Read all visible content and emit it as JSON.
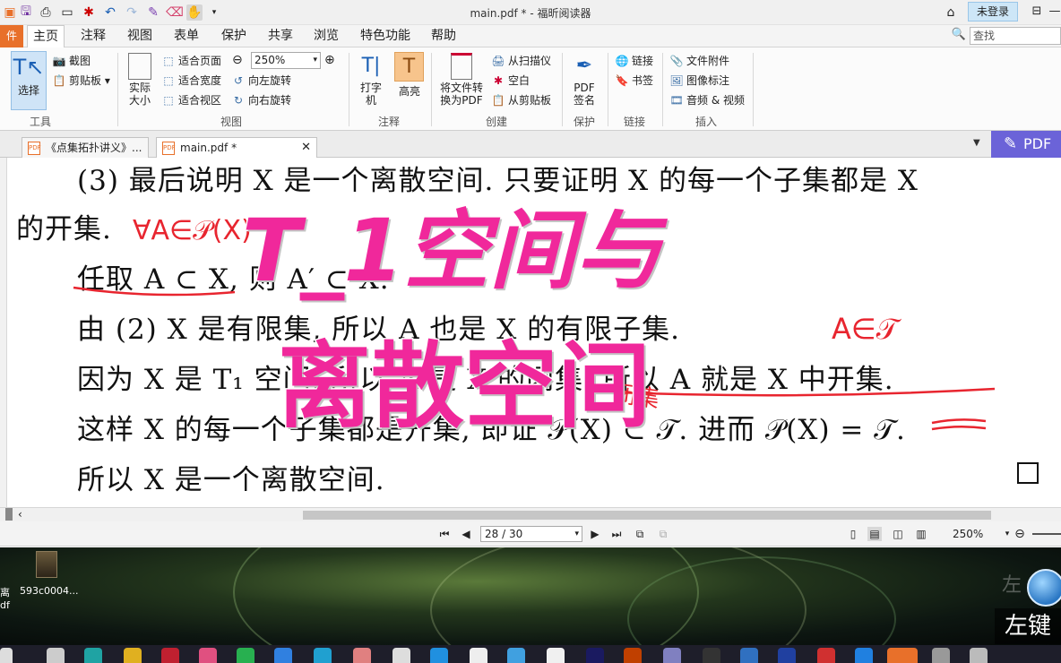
{
  "window": {
    "title": "main.pdf * - 福昕阅读器",
    "login_label": "未登录",
    "controls": [
      "⊟",
      "—"
    ]
  },
  "menu": {
    "file_label": "件",
    "tabs": [
      "主页",
      "注释",
      "视图",
      "表单",
      "保护",
      "共享",
      "浏览",
      "特色功能",
      "帮助"
    ],
    "active_tab": "主页",
    "search_placeholder": "查找"
  },
  "ribbon": {
    "tools": {
      "select_label": "选择",
      "snapshot_label": "截图",
      "clipboard_label": "剪贴板",
      "group_label": "工具"
    },
    "view": {
      "actual_size_label": "实际大小",
      "fit_page_label": "适合页面",
      "fit_width_label": "适合宽度",
      "fit_visible_label": "适合视区",
      "zoom_value": "250%",
      "rotate_left_label": "向左旋转",
      "rotate_right_label": "向右旋转",
      "group_label": "视图"
    },
    "comment": {
      "typewriter_label": "打字机",
      "highlight_label": "高亮",
      "group_label": "注释"
    },
    "create": {
      "convert_label": "将文件转换为PDF",
      "from_scanner_label": "从扫描仪",
      "blank_label": "空白",
      "from_clipboard_label": "从剪贴板",
      "group_label": "创建"
    },
    "protect": {
      "sign_label": "PDF签名",
      "group_label": "保护"
    },
    "links": {
      "link_label": "链接",
      "bookmark_label": "书签",
      "group_label": "链接"
    },
    "insert": {
      "attachment_label": "文件附件",
      "image_annot_label": "图像标注",
      "audio_video_label": "音频 & 视频",
      "group_label": "插入"
    }
  },
  "doc_tabs": [
    {
      "label": "《点集拓扑讲义》...",
      "active": false
    },
    {
      "label": "main.pdf *",
      "active": true
    }
  ],
  "pdf_badge": "PDF",
  "document": {
    "line1": "(3) 最后说明 X 是一个离散空间. 只要证明 X 的每一个子集都是 X",
    "line2": "的开集.",
    "line3": "任取 A ⊂ X, 则 A′ ⊂ X.",
    "line4": "由 (2) X 是有限集, 所以 A 也是 X 的有限子集.",
    "line5": "因为 X 是 T₁ 空间, 所以 A 是 X 的闭集, 所以 A 就是 X 中开集.",
    "line6": "这样 X 的每一个子集都是开集, 即证 𝒫(X) ⊂ 𝒯. 进而 𝒫(X) = 𝒯.",
    "line7": "所以 X 是一个离散空间."
  },
  "overlay": {
    "title_line1": "T_1空间与",
    "title_line2": "离散空间",
    "handwriting_1": "∀A∈𝒫(X)",
    "handwriting_2": "A∈𝒯",
    "handwriting_3": "闭集"
  },
  "status": {
    "page_display": "28 / 30",
    "current_page": 28,
    "total_pages": 30,
    "zoom_value": "250%"
  },
  "desktop": {
    "icon_label": "593c0004...",
    "left_labels": [
      "离",
      "df"
    ],
    "left_key_label": "左键"
  },
  "colors": {
    "overlay_pink": "#f0289b",
    "annotation_red": "#e8252f",
    "file_tab_orange": "#e8702a",
    "pdf_badge_purple": "#6b63d8",
    "login_blue": "#cde6f7"
  }
}
